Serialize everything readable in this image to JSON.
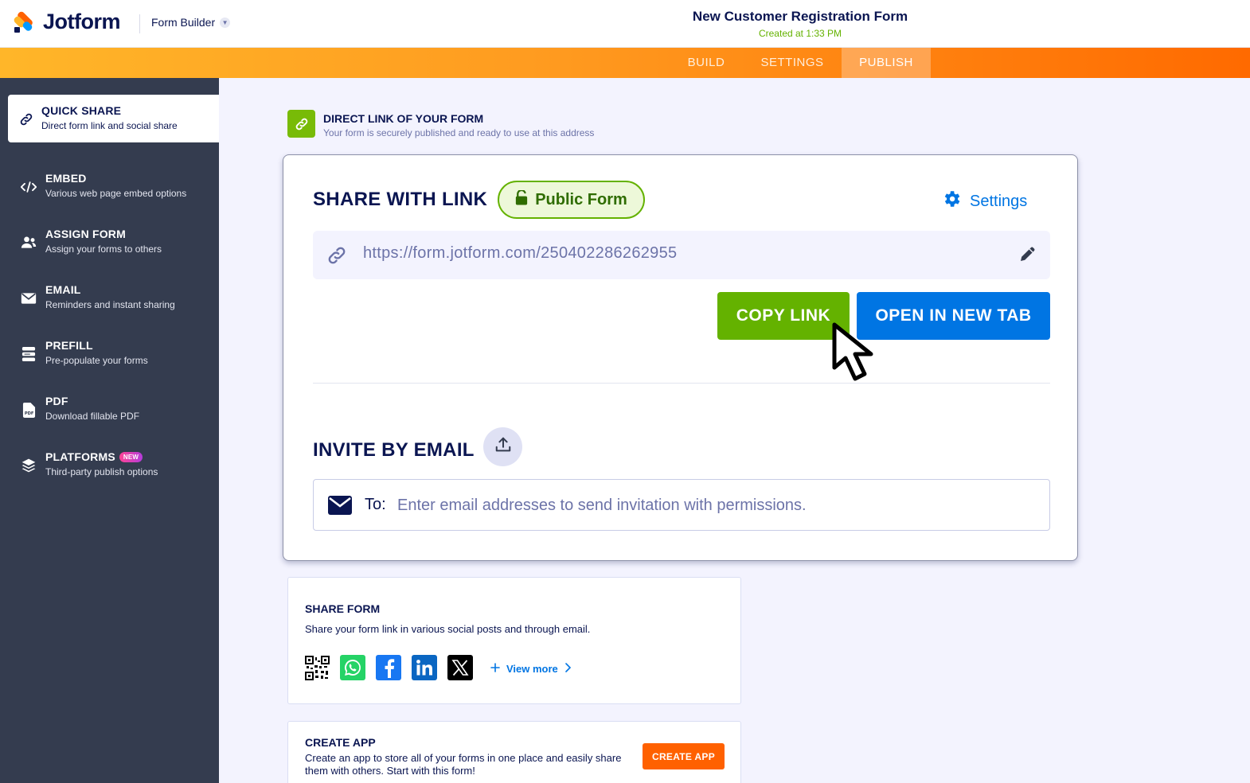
{
  "header": {
    "logo_text": "Jotform",
    "builder_label": "Form Builder",
    "form_title": "New Customer Registration Form",
    "created": "Created at 1:33 PM"
  },
  "nav": {
    "tabs": [
      {
        "label": "BUILD",
        "active": false
      },
      {
        "label": "SETTINGS",
        "active": false
      },
      {
        "label": "PUBLISH",
        "active": true
      }
    ]
  },
  "sidebar": {
    "items": [
      {
        "title": "QUICK SHARE",
        "subtitle": "Direct form link and social share",
        "icon": "link-icon",
        "active": true
      },
      {
        "title": "EMBED",
        "subtitle": "Various web page embed options",
        "icon": "code-icon"
      },
      {
        "title": "ASSIGN FORM",
        "subtitle": "Assign your forms to others",
        "icon": "users-icon"
      },
      {
        "title": "EMAIL",
        "subtitle": "Reminders and instant sharing",
        "icon": "envelope-icon"
      },
      {
        "title": "PREFILL",
        "subtitle": "Pre-populate your forms",
        "icon": "prefill-icon"
      },
      {
        "title": "PDF",
        "subtitle": "Download fillable PDF",
        "icon": "pdf-icon"
      },
      {
        "title": "PLATFORMS",
        "subtitle": "Third-party publish options",
        "icon": "layers-icon",
        "badge": "NEW"
      }
    ]
  },
  "direct_link": {
    "title": "DIRECT LINK OF YOUR FORM",
    "subtitle": "Your form is securely published and ready to use at this address"
  },
  "share_card": {
    "title": "SHARE WITH LINK",
    "pill": "Public Form",
    "settings": "Settings",
    "url": "https://form.jotform.com/250402286262955",
    "copy_button": "COPY LINK",
    "open_button": "OPEN IN NEW TAB",
    "invite_title": "INVITE BY EMAIL",
    "to_label": "To:",
    "email_placeholder": "Enter email addresses to send invitation with permissions."
  },
  "share_form": {
    "title": "SHARE FORM",
    "description": "Share your form link in various social posts and through email.",
    "socials": [
      "qr-code-icon",
      "whatsapp-icon",
      "facebook-icon",
      "linkedin-icon",
      "x-icon"
    ],
    "view_more": "View more"
  },
  "create_app": {
    "title": "CREATE APP",
    "description": "Create an app to store all of your forms in one place and easily share them with others. Start with this form!",
    "button": "CREATE APP"
  },
  "colors": {
    "green": "#64b200",
    "blue": "#0075e3",
    "orange": "#ff6100",
    "navy": "#0a1551",
    "sidebar": "#343c4f"
  }
}
